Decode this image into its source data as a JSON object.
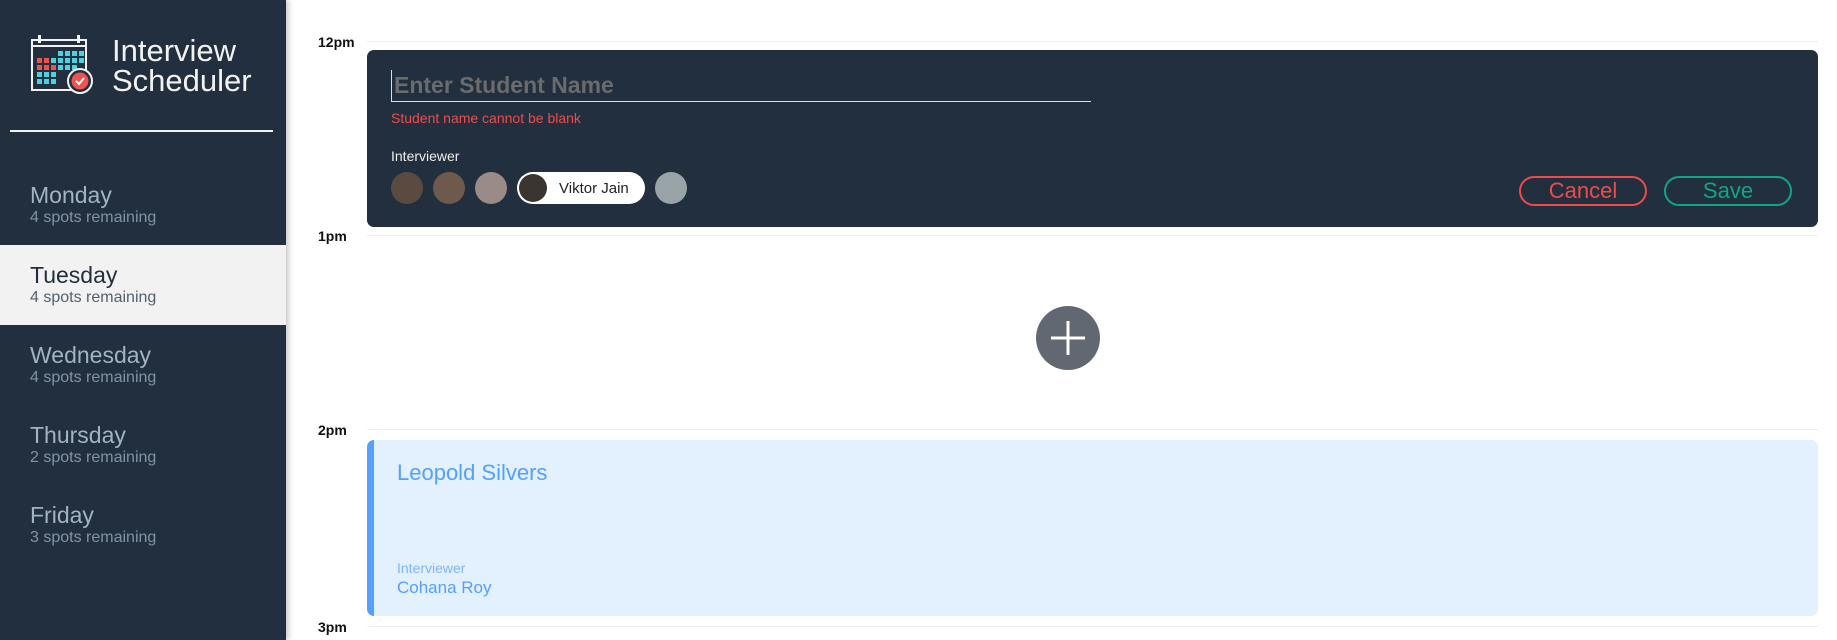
{
  "app": {
    "title_line1": "Interview",
    "title_line2": "Scheduler"
  },
  "days": [
    {
      "name": "Monday",
      "spots": "4 spots remaining"
    },
    {
      "name": "Tuesday",
      "spots": "4 spots remaining",
      "selected": true
    },
    {
      "name": "Wednesday",
      "spots": "4 spots remaining"
    },
    {
      "name": "Thursday",
      "spots": "2 spots remaining"
    },
    {
      "name": "Friday",
      "spots": "3 spots remaining"
    }
  ],
  "times": [
    "12pm",
    "1pm",
    "2pm",
    "3pm"
  ],
  "form": {
    "placeholder": "Enter Student Name",
    "value": "",
    "error": "Student name cannot be blank",
    "interviewer_label": "Interviewer",
    "selected_interviewer": "Viktor Jain",
    "cancel": "Cancel",
    "save": "Save"
  },
  "appointment": {
    "student": "Leopold Silvers",
    "interviewer_label": "Interviewer",
    "interviewer": "Cohana Roy"
  },
  "colors": {
    "sidebar": "#222f3e",
    "error": "#f04b4b",
    "save": "#11a683",
    "appointment_accent": "#54a0ff"
  }
}
